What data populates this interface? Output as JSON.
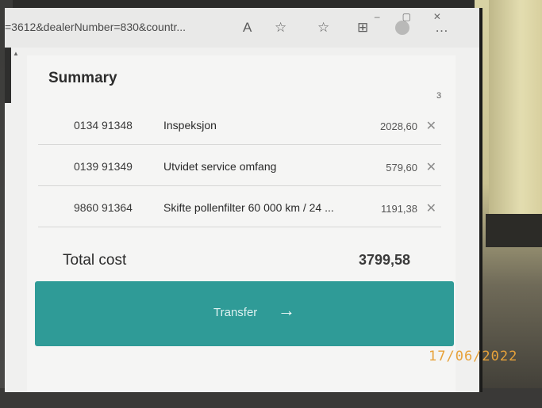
{
  "browser": {
    "url": "=3612&dealerNumber=830&countr..."
  },
  "summary": {
    "title": "Summary",
    "count": "3",
    "items": [
      {
        "number": "0134 91348",
        "description": "Inspeksjon",
        "price": "2028,60",
        "remove": "✕"
      },
      {
        "number": "0139 91349",
        "description": "Utvidet service omfang",
        "price": "579,60",
        "remove": "✕"
      },
      {
        "number": "9860 91364",
        "description": "Skifte pollenfilter 60 000 km / 24 ...",
        "price": "1191,38",
        "remove": "✕"
      }
    ],
    "total_label": "Total cost",
    "total_value": "3799,58"
  },
  "transfer": {
    "label": "Transfer",
    "arrow": "→"
  },
  "photo": {
    "date_stamp": "17/06/2022"
  },
  "icons": {
    "read_aloud": "read-aloud-icon",
    "add_favorite": "add-favorite-icon",
    "favorites": "favorites-icon",
    "collections": "collections-icon",
    "profile": "profile-icon",
    "more": "more-icon"
  },
  "colors": {
    "accent": "#2f9b97",
    "date_stamp": "#e7a23a"
  }
}
